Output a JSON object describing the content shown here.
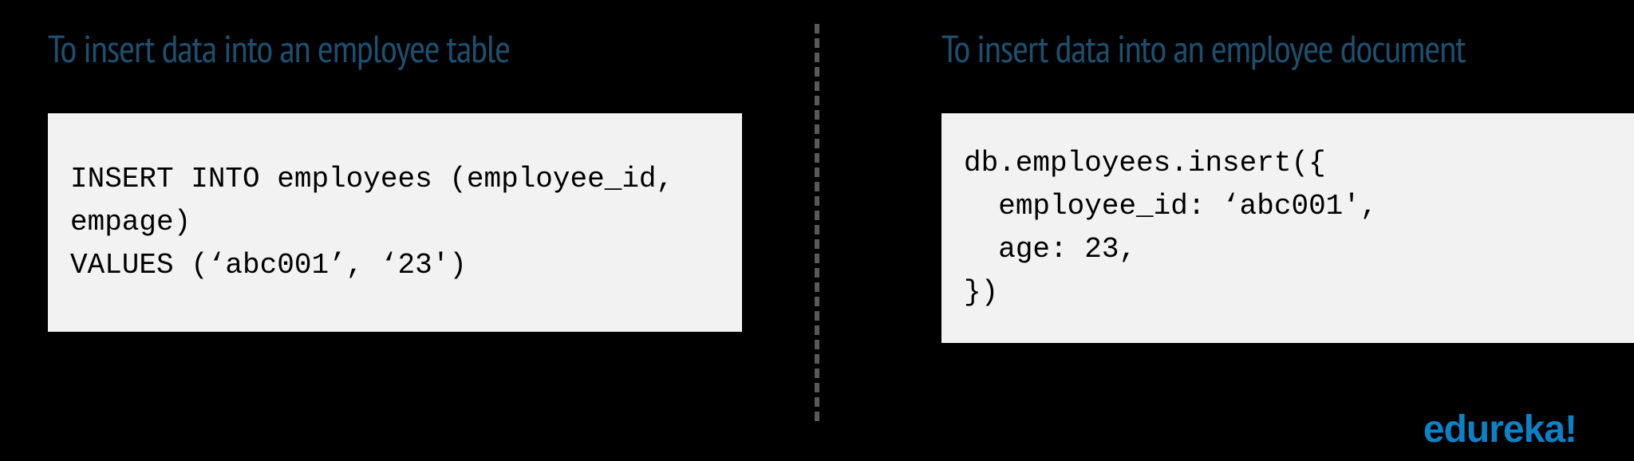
{
  "left": {
    "heading": "To insert data into an employee table",
    "code": "INSERT INTO employees (employee_id, empage)\nVALUES (‘abc001’, ‘23')"
  },
  "right": {
    "heading": "To insert data into an employee document",
    "code": "db.employees.insert({\n  employee_id: ‘abc001',\n  age: 23,\n})"
  },
  "brand": "edureka!"
}
